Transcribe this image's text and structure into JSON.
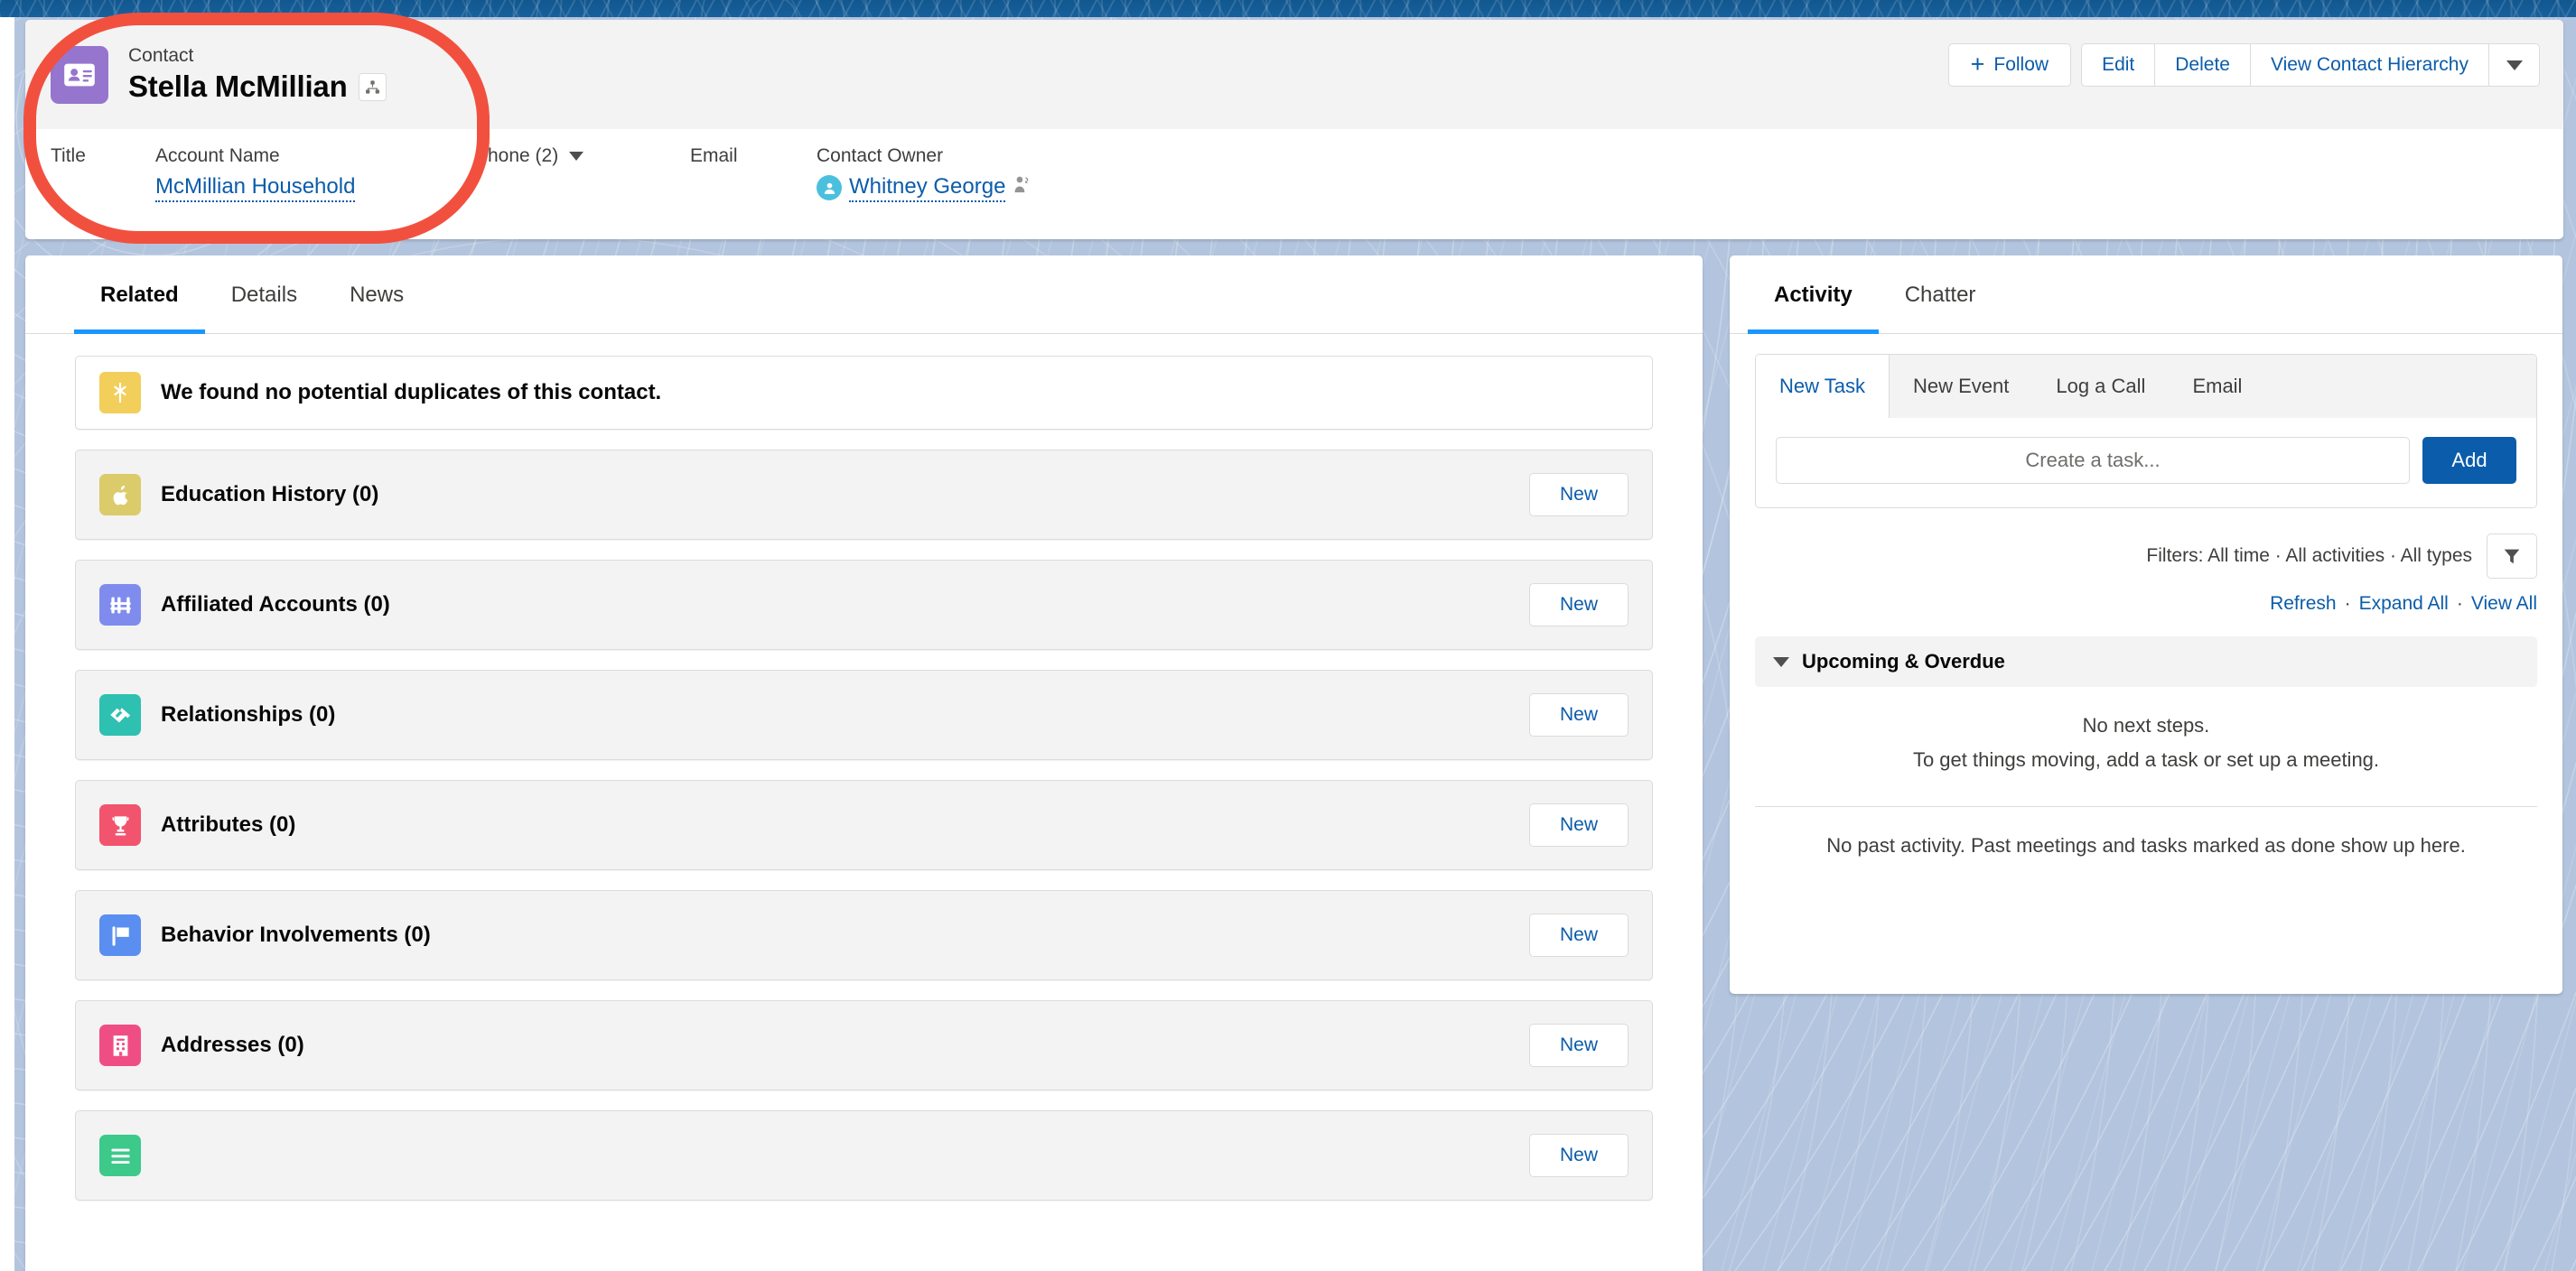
{
  "theme": {
    "bg": "#b3c5de",
    "top_strip": "#17609c",
    "link": "#0b5cab",
    "accent_tab": "#1b96ff",
    "annotation": "#f2503f"
  },
  "record_header": {
    "entity_icon": "contact-icon",
    "entity_label": "Contact",
    "record_name": "Stella McMillian",
    "hierarchy_icon": "hierarchy-icon",
    "actions": {
      "follow": "Follow",
      "edit": "Edit",
      "delete": "Delete",
      "view_hierarchy": "View Contact Hierarchy",
      "more_icon": "chevron-down-icon"
    },
    "fields": [
      {
        "label": "Title",
        "value": ""
      },
      {
        "label": "Account Name",
        "value": "McMillian Household",
        "is_link": true
      },
      {
        "label": "Phone (2)",
        "value": "",
        "has_caret": true
      },
      {
        "label": "Email",
        "value": ""
      },
      {
        "label": "Contact Owner",
        "value": "Whitney George",
        "is_link": true,
        "avatar": "user-avatar-icon",
        "change_owner_icon": "change-owner-icon"
      }
    ]
  },
  "left_panel": {
    "tabs": [
      {
        "label": "Related",
        "active": true
      },
      {
        "label": "Details",
        "active": false
      },
      {
        "label": "News",
        "active": false
      }
    ],
    "duplicate_banner": {
      "icon": "duplicate-merge-icon",
      "text": "We found no potential duplicates of this contact."
    },
    "related_lists": [
      {
        "title": "Education History (0)",
        "icon": "apple-icon",
        "icon_color": "#dbcb6a",
        "button": "New"
      },
      {
        "title": "Affiliated Accounts (0)",
        "icon": "affiliation-icon",
        "icon_color": "#7f8ced",
        "button": "New"
      },
      {
        "title": "Relationships (0)",
        "icon": "handshake-icon",
        "icon_color": "#2ec0b0",
        "button": "New"
      },
      {
        "title": "Attributes (0)",
        "icon": "trophy-icon",
        "icon_color": "#f2536d",
        "button": "New"
      },
      {
        "title": "Behavior Involvements (0)",
        "icon": "flag-icon",
        "icon_color": "#5a8ef0",
        "button": "New"
      },
      {
        "title": "Addresses (0)",
        "icon": "address-building-icon",
        "icon_color": "#ef4e84",
        "button": "New"
      },
      {
        "title": "",
        "icon": "list-icon",
        "icon_color": "#3cc98a",
        "button": "New"
      }
    ]
  },
  "right_panel": {
    "tabs": [
      {
        "label": "Activity",
        "active": true
      },
      {
        "label": "Chatter",
        "active": false
      }
    ],
    "composer": {
      "tabs": [
        {
          "label": "New Task",
          "active": true
        },
        {
          "label": "New Event",
          "active": false
        },
        {
          "label": "Log a Call",
          "active": false
        },
        {
          "label": "Email",
          "active": false
        }
      ],
      "task_input_placeholder": "Create a task...",
      "task_input_value": "",
      "add_button": "Add"
    },
    "filters": {
      "text": "Filters: All time · All activities · All types",
      "icon": "filter-funnel-icon"
    },
    "links": {
      "refresh": "Refresh",
      "expand_all": "Expand All",
      "view_all": "View All",
      "separator": "·"
    },
    "upcoming_section": {
      "chevron_icon": "chevron-down-icon",
      "title": "Upcoming & Overdue",
      "empty_line_1": "No next steps.",
      "empty_line_2": "To get things moving, add a task or set up a meeting."
    },
    "past_activity_empty": "No past activity. Past meetings and tasks marked as done show up here."
  },
  "annotation": {
    "shape": "oval-highlight",
    "color": "#f2503f"
  }
}
